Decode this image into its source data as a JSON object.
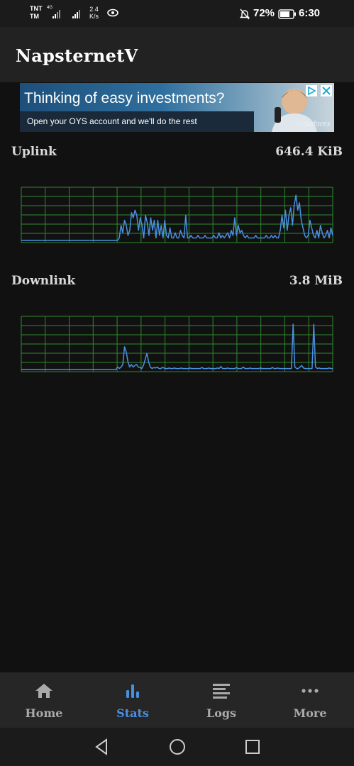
{
  "status_bar": {
    "carrier": "TNT",
    "carrier2": "TM",
    "network_type": "4G",
    "speed_value": "2.4",
    "speed_unit": "K/s",
    "battery": "72%",
    "time": "6:30"
  },
  "app": {
    "title": "NapsternetV"
  },
  "ad": {
    "headline": "Thinking of easy investments?",
    "body": "Open your OYS account and we'll do the rest",
    "brand": "instaforex"
  },
  "stats": {
    "uplink": {
      "label": "Uplink",
      "value": "646.4 KiB",
      "series": [
        0,
        0,
        0,
        0,
        0,
        0,
        0,
        0,
        0,
        0,
        0,
        0,
        0,
        0,
        0,
        0,
        0,
        0,
        0,
        0,
        0,
        0,
        0,
        0,
        0,
        0,
        0,
        0,
        0,
        0,
        0,
        0,
        0,
        0,
        0,
        0,
        0,
        0,
        0,
        0,
        0,
        0,
        0,
        0,
        0,
        0,
        0,
        0,
        0,
        0,
        0,
        0,
        0,
        0,
        0,
        0,
        0.05,
        0.3,
        0.15,
        0.4,
        0.3,
        0.1,
        0.2,
        0.55,
        0.45,
        0.6,
        0.5,
        0.2,
        0.45,
        0.3,
        0.05,
        0.5,
        0.35,
        0.1,
        0.45,
        0.2,
        0.4,
        0.05,
        0.4,
        0.1,
        0.3,
        0.05,
        0.4,
        0.1,
        0.05,
        0.25,
        0.05,
        0.05,
        0.15,
        0.05,
        0.05,
        0.2,
        0.1,
        0.05,
        0.5,
        0.05,
        0.05,
        0.1,
        0.05,
        0.05,
        0.05,
        0.1,
        0.05,
        0.05,
        0.05,
        0.1,
        0.05,
        0.05,
        0.05,
        0.05,
        0.1,
        0.05,
        0.05,
        0.15,
        0.05,
        0.1,
        0.05,
        0.1,
        0.15,
        0.05,
        0.2,
        0.1,
        0.45,
        0.1,
        0.3,
        0.15,
        0.2,
        0.1,
        0.05,
        0.1,
        0.05,
        0.05,
        0.05,
        0.05,
        0.1,
        0.05,
        0.05,
        0.05,
        0.05,
        0.05,
        0.1,
        0.05,
        0.05,
        0.1,
        0.05,
        0.1,
        0.05,
        0.05,
        0.2,
        0.5,
        0.25,
        0.6,
        0.2,
        0.5,
        0.65,
        0.3,
        0.7,
        0.9,
        0.6,
        0.75,
        0.4,
        0.25,
        0.1,
        0.05,
        0.1,
        0.4,
        0.25,
        0.1,
        0.05,
        0.2,
        0.05,
        0.3,
        0.15,
        0.05,
        0.1,
        0.2,
        0.05,
        0.25,
        0.1
      ]
    },
    "downlink": {
      "label": "Downlink",
      "value": "3.8 MiB",
      "series": [
        0,
        0,
        0,
        0,
        0,
        0,
        0,
        0,
        0,
        0,
        0,
        0,
        0,
        0,
        0,
        0,
        0,
        0,
        0,
        0,
        0,
        0,
        0,
        0,
        0,
        0,
        0,
        0,
        0,
        0,
        0,
        0,
        0,
        0,
        0,
        0,
        0,
        0,
        0,
        0,
        0,
        0,
        0,
        0,
        0,
        0,
        0,
        0,
        0,
        0,
        0,
        0,
        0,
        0,
        0,
        0,
        0.05,
        0.02,
        0.05,
        0.1,
        0.45,
        0.35,
        0.15,
        0.05,
        0.1,
        0.05,
        0.08,
        0.1,
        0.05,
        0.04,
        0.02,
        0.08,
        0.2,
        0.32,
        0.15,
        0.05,
        0.02,
        0.04,
        0.03,
        0.05,
        0.02,
        0.02,
        0.04,
        0.03,
        0.02,
        0.02,
        0.03,
        0.02,
        0.02,
        0.03,
        0.02,
        0.02,
        0.02,
        0.03,
        0.02,
        0.02,
        0.02,
        0.02,
        0.03,
        0.02,
        0.02,
        0.02,
        0.02,
        0.02,
        0.02,
        0.04,
        0.02,
        0.02,
        0.02,
        0.03,
        0.02,
        0.02,
        0.02,
        0.02,
        0.03,
        0.02,
        0.06,
        0.02,
        0.02,
        0.02,
        0.03,
        0.02,
        0.02,
        0.02,
        0.02,
        0.04,
        0.02,
        0.02,
        0.02,
        0.05,
        0.02,
        0.02,
        0.02,
        0.03,
        0.02,
        0.02,
        0.02,
        0.02,
        0.02,
        0.03,
        0.02,
        0.02,
        0.02,
        0.02,
        0.02,
        0.02,
        0.04,
        0.02,
        0.02,
        0.03,
        0.02,
        0.02,
        0.02,
        0.02,
        0.02,
        0.02,
        0.02,
        0.02,
        0.9,
        0.05,
        0.02,
        0.02,
        0.05,
        0.08,
        0.03,
        0.02,
        0.02,
        0.02,
        0.02,
        0.02,
        0.9,
        0.05,
        0.02,
        0.03,
        0.02,
        0.02,
        0.02,
        0.02,
        0.02,
        0.03,
        0.02,
        0.02
      ]
    },
    "colors": {
      "line": "#4a90e2",
      "grid": "#2e8b2e"
    }
  },
  "nav": {
    "items": [
      {
        "label": "Home",
        "icon": "home-icon"
      },
      {
        "label": "Stats",
        "icon": "stats-icon"
      },
      {
        "label": "Logs",
        "icon": "logs-icon"
      },
      {
        "label": "More",
        "icon": "more-icon"
      }
    ],
    "active": "Stats",
    "active_color": "#4a90e2"
  }
}
